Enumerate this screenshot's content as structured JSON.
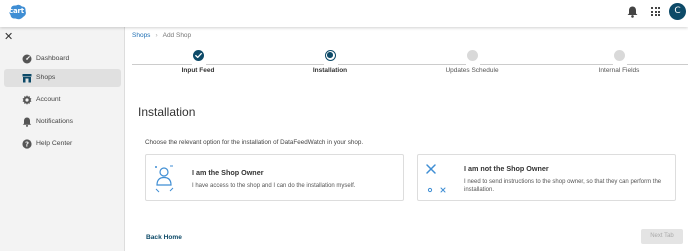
{
  "app": {
    "logo_text": "cart"
  },
  "user": {
    "initial": "C"
  },
  "sidebar": {
    "items": [
      {
        "label": "Dashboard",
        "icon": "dashboard-icon",
        "active": false
      },
      {
        "label": "Shops",
        "icon": "shop-icon",
        "active": true
      },
      {
        "label": "Account",
        "icon": "gear-icon",
        "active": false
      },
      {
        "label": "Notifications",
        "icon": "bell-icon",
        "active": false
      },
      {
        "label": "Help Center",
        "icon": "help-icon",
        "active": false
      }
    ]
  },
  "breadcrumb": {
    "parent": "Shops",
    "current": "Add Shop"
  },
  "steps": [
    {
      "label": "Input Feed",
      "state": "done"
    },
    {
      "label": "Installation",
      "state": "current"
    },
    {
      "label": "Updates Schedule",
      "state": "pending"
    },
    {
      "label": "Internal Fields",
      "state": "pending"
    }
  ],
  "page": {
    "title": "Installation",
    "intro": "Choose the relevant option for the installation of DataFeedWatch in your shop."
  },
  "options": [
    {
      "title": "I am the Shop Owner",
      "description": "I have access to the shop and I can do the installation myself."
    },
    {
      "title": "I am not the Shop Owner",
      "description": "I need to send instructions to the shop owner, so that they can perform the installation."
    }
  ],
  "footer": {
    "back_label": "Back Home",
    "next_label": "Next Tab"
  },
  "colors": {
    "accent": "#0d4a68",
    "link": "#1f6fb3",
    "step_done": "#0d4a68",
    "step_pending": "#d9d9d9",
    "icon_blue": "#3f8ed4"
  }
}
